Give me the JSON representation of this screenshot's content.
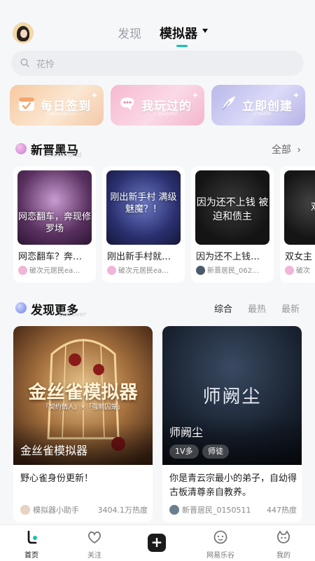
{
  "header": {
    "tabs": [
      {
        "label": "发现"
      },
      {
        "label": "模拟器"
      }
    ]
  },
  "search": {
    "placeholder": "花怜"
  },
  "features": [
    {
      "label": "每日签到",
      "sub": "dailysignin",
      "icon": "calendar-check-icon"
    },
    {
      "label": "我玩过的",
      "sub": "played",
      "icon": "chat-bubble-icon"
    },
    {
      "label": "立即创建",
      "sub": "create",
      "icon": "quill-icon"
    }
  ],
  "new_section": {
    "title": "新晋黑马",
    "ghost": "recommend",
    "more": "全部"
  },
  "new_cards": [
    {
      "cover_text": "网恋翻车，奔现修罗场",
      "title": "网恋翻车？奔…",
      "author": "破次元居民ea…"
    },
    {
      "cover_text": "刚出新手村 满级魅魔？！",
      "title": "刚出新手村就…",
      "author": "破次元居民ea…"
    },
    {
      "cover_text": "因为还不上钱 被迫和债主",
      "title": "因为还不上钱…",
      "author": "新晋居民_062…"
    },
    {
      "cover_text": "双",
      "title": "双女主",
      "author": "破次"
    }
  ],
  "discover_section": {
    "title": "发现更多",
    "ghost": "Discover",
    "sorts": [
      "综合",
      "最热",
      "最新"
    ]
  },
  "big_cards": [
    {
      "cover_title": "金丝雀模拟器",
      "cover_art": "金丝雀模拟器",
      "cover_tagline": "「契约情人」×「强制囚笼」",
      "desc": "野心雀身份更新！",
      "author": "模拟器小助手",
      "heat": "3404.1万热度"
    },
    {
      "cover_title": "师阙尘",
      "cover_art": "师阙尘",
      "tags": [
        "1V多",
        "师徒"
      ],
      "desc": "你是青云宗最小的弟子，自幼得古板清尊亲自教养。",
      "author": "新晋居民_0150511",
      "heat": "447热度"
    }
  ],
  "nav": [
    {
      "label": "首页",
      "icon": "home-icon"
    },
    {
      "label": "关注",
      "icon": "heart-icon"
    },
    {
      "label": "",
      "icon": "plus-icon"
    },
    {
      "label": "网易乐谷",
      "icon": "face-icon"
    },
    {
      "label": "我的",
      "icon": "profile-icon"
    }
  ],
  "colors": {
    "accent": "#16c2b4",
    "background": "#f6f7f9"
  }
}
